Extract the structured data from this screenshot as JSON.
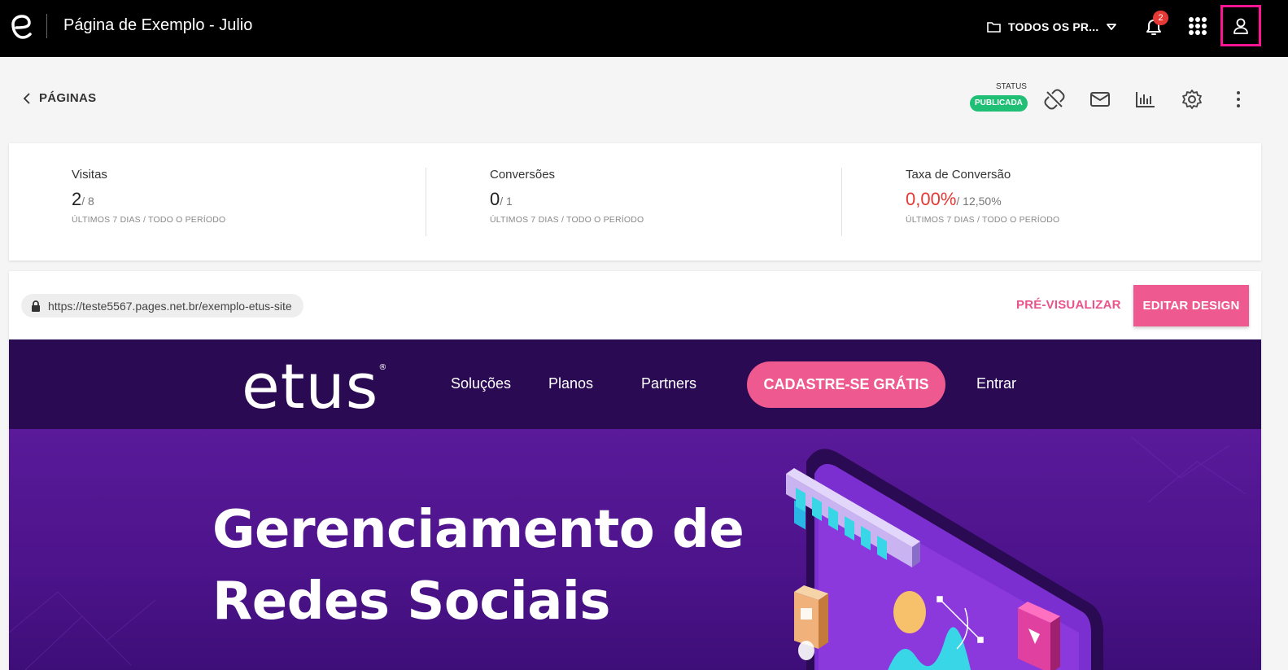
{
  "topbar": {
    "title": "Página de Exemplo - Julio",
    "project_selector": "TODOS OS PR...",
    "notification_count": "2"
  },
  "subheader": {
    "back_label": "PÁGINAS",
    "status_label": "STATUS",
    "status_value": "PUBLICADA",
    "status_color": "#1fbf75"
  },
  "metrics": [
    {
      "label": "Visitas",
      "value": "2",
      "total": "/ 8",
      "caption": "ÚLTIMOS 7 DIAS / TODO O PERÍODO"
    },
    {
      "label": "Conversões",
      "value": "0",
      "total": "/ 1",
      "caption": "ÚLTIMOS 7 DIAS / TODO O PERÍODO"
    },
    {
      "label": "Taxa de Conversão",
      "value": "0,00%",
      "total": "/ 12,50%",
      "caption": "ÚLTIMOS 7 DIAS / TODO O PERÍODO"
    }
  ],
  "preview": {
    "url": "https://teste5567.pages.net.br/exemplo-etus-site",
    "preview_label": "PRÉ-VISUALIZAR",
    "edit_label": "EDITAR DESIGN",
    "accent_color": "#ee5a8f"
  },
  "site": {
    "logo": "etus",
    "logo_mark": "®",
    "nav": [
      "Soluções",
      "Planos",
      "Partners"
    ],
    "cta": "CADASTRE-SE GRÁTIS",
    "login": "Entrar",
    "hero_line1": "Gerenciamento de",
    "hero_line2": "Redes Sociais"
  }
}
